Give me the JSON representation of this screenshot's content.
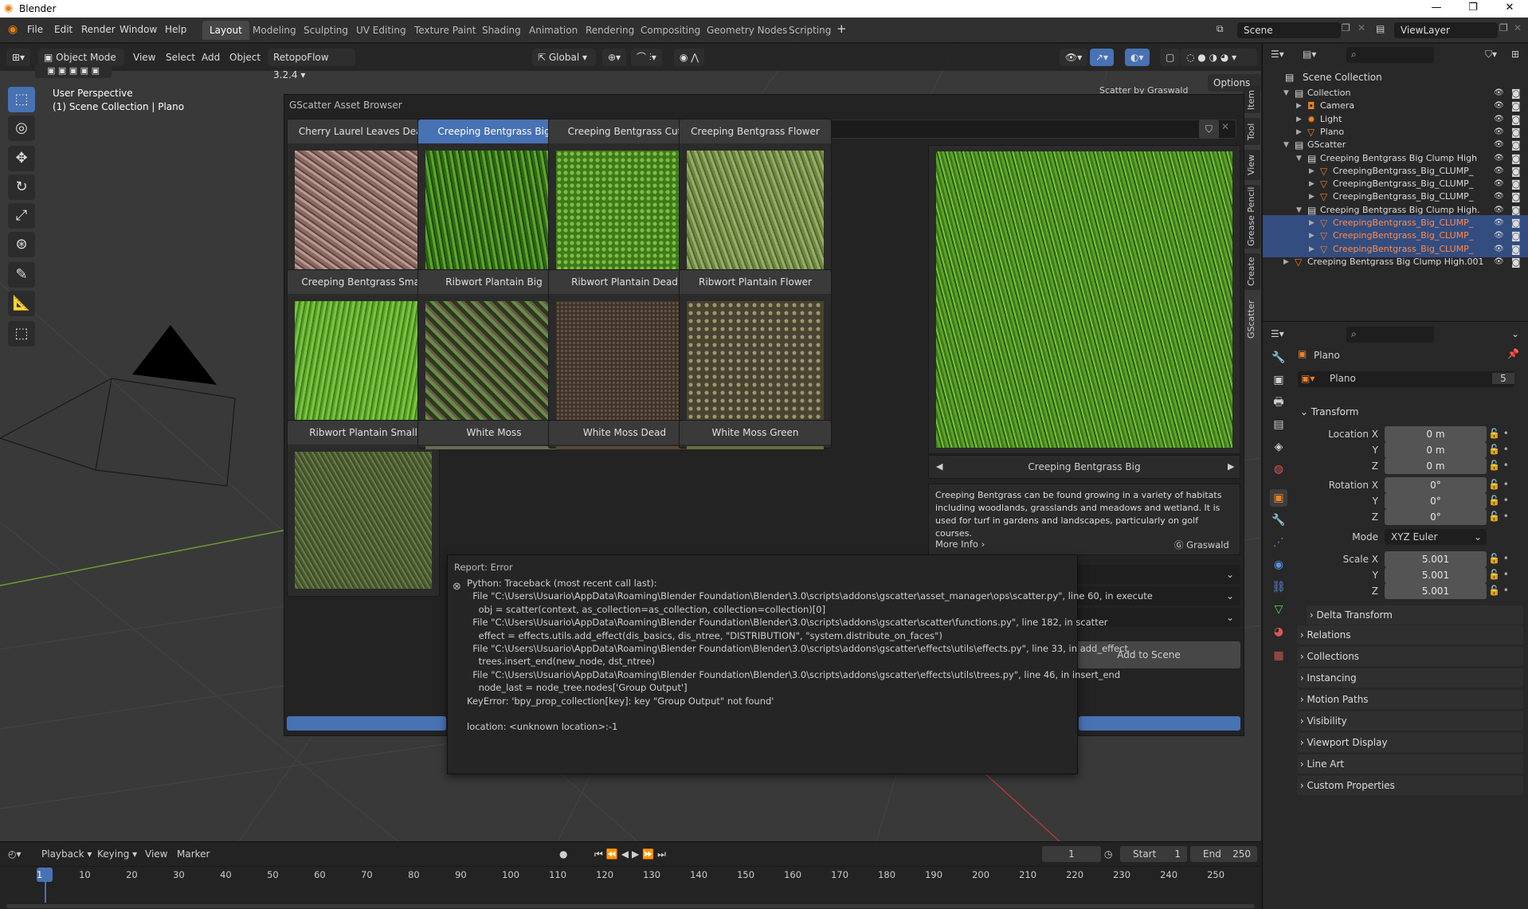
{
  "window": {
    "title": "Blender",
    "app_icon": "blender-logo-icon"
  },
  "menu": [
    "File",
    "Edit",
    "Render",
    "Window",
    "Help"
  ],
  "workspaces": [
    "Layout",
    "Modeling",
    "Sculpting",
    "UV Editing",
    "Texture Paint",
    "Shading",
    "Animation",
    "Rendering",
    "Compositing",
    "Geometry Nodes",
    "Scripting"
  ],
  "active_workspace": "Layout",
  "scene": {
    "label": "Scene",
    "view_layer": "ViewLayer"
  },
  "vp_header": {
    "mode": "Object Mode",
    "menus": [
      "View",
      "Select",
      "Add",
      "Object"
    ],
    "addon": "RetopoFlow 3.2.4",
    "transform": "Global",
    "options": "Options"
  },
  "viewport": {
    "perspective": "User Perspective",
    "collection": "(1) Scene Collection | Plano",
    "overlay_hint": "Scatter by Graswald"
  },
  "sidebar_tabs": [
    "Item",
    "Tool",
    "View",
    "Grease Pencil",
    "Create",
    "GScatter"
  ],
  "gscatter": {
    "title": "GScatter Asset Browser",
    "search_placeholder": "",
    "assets": [
      {
        "name": "Cherry Laurel Leaves Dead",
        "tex": "leaves"
      },
      {
        "name": "Creeping Bentgrass Big",
        "tex": "grass",
        "selected": true
      },
      {
        "name": "Creeping Bentgrass Cut",
        "tex": "grasscut"
      },
      {
        "name": "Creeping Bentgrass Flower",
        "tex": "grassflower"
      },
      {
        "name": "Creeping Bentgrass Small",
        "tex": "grasssmall"
      },
      {
        "name": "Ribwort Plantain Big",
        "tex": "plantain"
      },
      {
        "name": "Ribwort Plantain Dead",
        "tex": "dirt"
      },
      {
        "name": "Ribwort Plantain Flower",
        "tex": "plantainflower"
      },
      {
        "name": "Ribwort Plantain Small",
        "tex": "grassflat"
      },
      {
        "name": "White Moss",
        "tex": "moss"
      },
      {
        "name": "White Moss Dead",
        "tex": "mossdead"
      },
      {
        "name": "White Moss Green",
        "tex": "mossgreen"
      }
    ],
    "preview_name": "Creeping Bentgrass Big",
    "description": "Creeping Bentgrass can be found growing in a variety of habitats including woodlands, grasslands and meadows and wetland. It is used for turf in gardens and landscapes, particularly on golf courses.",
    "more_info": "More Info",
    "vendor": "Graswald",
    "dropdowns": [
      "mp",
      "h",
      "h"
    ],
    "add_button": "Add to Scene"
  },
  "report": {
    "title": "Report: Error",
    "lines": [
      "Python: Traceback (most recent call last):",
      "  File \"C:\\Users\\Usuario\\AppData\\Roaming\\Blender Foundation\\Blender\\3.0\\scripts\\addons\\gscatter\\asset_manager\\ops\\scatter.py\", line 60, in execute",
      "    obj = scatter(context, as_collection=as_collection, collection=collection)[0]",
      "  File \"C:\\Users\\Usuario\\AppData\\Roaming\\Blender Foundation\\Blender\\3.0\\scripts\\addons\\gscatter\\scatter\\functions.py\", line 182, in scatter",
      "    effect = effects.utils.add_effect(dis_basics, dis_ntree, \"DISTRIBUTION\", \"system.distribute_on_faces\")",
      "  File \"C:\\Users\\Usuario\\AppData\\Roaming\\Blender Foundation\\Blender\\3.0\\scripts\\addons\\gscatter\\effects\\utils\\effects.py\", line 33, in add_effect",
      "    trees.insert_end(new_node, dst_ntree)",
      "  File \"C:\\Users\\Usuario\\AppData\\Roaming\\Blender Foundation\\Blender\\3.0\\scripts\\addons\\gscatter\\effects\\utils\\trees.py\", line 46, in insert_end",
      "    node_last = node_tree.nodes['Group Output']",
      "KeyError: 'bpy_prop_collection[key]: key \"Group Output\" not found'",
      "",
      "location: <unknown location>:-1"
    ]
  },
  "outliner": {
    "root": "Scene Collection",
    "rows": [
      {
        "name": "Collection",
        "icon": "collection-icon"
      },
      {
        "name": "Camera",
        "icon": "camera-icon"
      },
      {
        "name": "Light",
        "icon": "light-icon"
      },
      {
        "name": "Plano",
        "icon": "mesh-icon"
      },
      {
        "name": "GScatter",
        "icon": "collection-icon"
      },
      {
        "name": "Creeping Bentgrass Big Clump High",
        "icon": "collection-icon"
      },
      {
        "name": "CreepingBentgrass_Big_CLUMP_",
        "icon": "mesh-icon"
      },
      {
        "name": "CreepingBentgrass_Big_CLUMP_",
        "icon": "mesh-icon"
      },
      {
        "name": "CreepingBentgrass_Big_CLUMP_",
        "icon": "mesh-icon"
      },
      {
        "name": "Creeping Bentgrass Big Clump High.",
        "icon": "collection-icon"
      },
      {
        "name": "CreepingBentgrass_Big_CLUMP_",
        "icon": "mesh-icon"
      },
      {
        "name": "CreepingBentgrass_Big_CLUMP_",
        "icon": "mesh-icon"
      },
      {
        "name": "CreepingBentgrass_Big_CLUMP_",
        "icon": "mesh-icon"
      },
      {
        "name": "Creeping Bentgrass Big Clump High.001",
        "icon": "mesh-icon"
      }
    ]
  },
  "properties": {
    "object": "Plano",
    "data_name": "Plano",
    "users": "5",
    "transform": "Transform",
    "location_label": "Location X",
    "location": [
      "0 m",
      "0 m",
      "0 m"
    ],
    "rotation_label": "Rotation X",
    "rotation": [
      "0°",
      "0°",
      "0°"
    ],
    "mode_label": "Mode",
    "mode": "XYZ Euler",
    "scale_label": "Scale X",
    "scale": [
      "5.001",
      "5.001",
      "5.001"
    ],
    "y": "Y",
    "z": "Z",
    "sections": [
      "Delta Transform",
      "Relations",
      "Collections",
      "Instancing",
      "Motion Paths",
      "Visibility",
      "Viewport Display",
      "Line Art",
      "Custom Properties"
    ]
  },
  "timeline": {
    "menus": [
      "Playback",
      "Keying",
      "View",
      "Marker"
    ],
    "current_frame": "1",
    "start_label": "Start",
    "start": "1",
    "end_label": "End",
    "end": "250",
    "ticks": [
      "1",
      "10",
      "20",
      "30",
      "40",
      "50",
      "60",
      "70",
      "80",
      "90",
      "100",
      "110",
      "120",
      "130",
      "140",
      "150",
      "160",
      "170",
      "180",
      "190",
      "200",
      "210",
      "220",
      "230",
      "240",
      "250"
    ]
  },
  "colors": {
    "accent": "#4772b3",
    "selected_text": "#ff8a4a",
    "bg": "#393939"
  }
}
